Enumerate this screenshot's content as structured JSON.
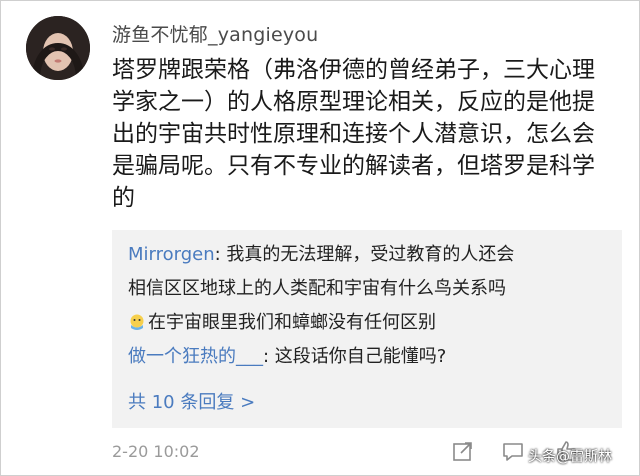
{
  "comment": {
    "username": "游鱼不忧郁_yangieyou",
    "lines": [
      "塔罗牌跟荣格（弗洛伊德的曾经弟子，三大心理",
      "学家之一）的人格原型理论相关，反应的是他提",
      "出的宇宙共时性原理和连接个人潜意识，怎么会",
      "是骗局呢。只有不专业的解读者，但塔罗是科学",
      "的"
    ],
    "timestamp": "2-20 10:02"
  },
  "replies": {
    "items": [
      {
        "user": "Mirrorgen",
        "sep": ": ",
        "line1": "我真的无法理解，受过教育的人还会",
        "line2": "相信区区地球上的人类配和宇宙有什么鸟关系吗",
        "line3": "在宇宙眼里我们和蟑螂没有任何区别"
      },
      {
        "mention": "做一个狂热的___",
        "sep": ": ",
        "text": "这段话你自己能懂吗?"
      }
    ],
    "more_label": "共 10 条回复 >"
  },
  "icons": {
    "share": "share-icon",
    "comment": "comment-icon",
    "like": "like-icon",
    "emoji": "emoji-icon"
  },
  "watermark": "头条@雷斯林"
}
